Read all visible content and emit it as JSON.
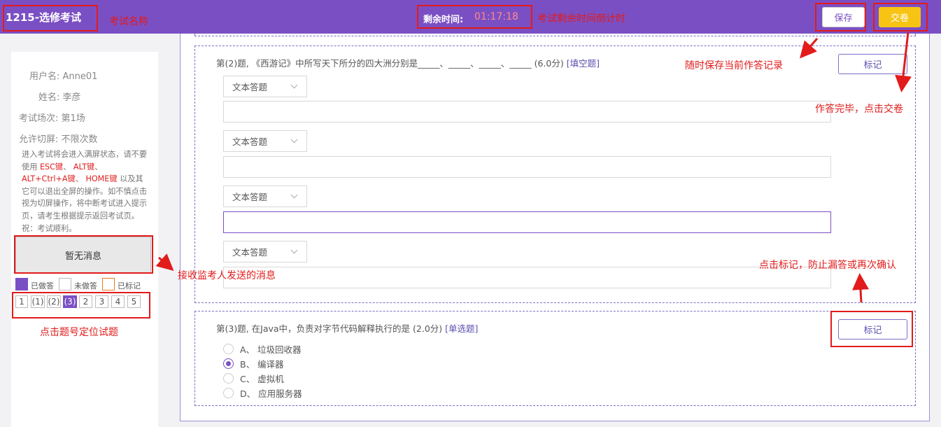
{
  "header": {
    "exam_title": "1215-选修考试",
    "timer_label": "剩余时间:",
    "timer_value": "01:17:18",
    "save_label": "保存",
    "submit_label": "交卷"
  },
  "sidebar": {
    "username": "用户名: Anne01",
    "name": "姓名: 李彦",
    "session": "考试场次: 第1场",
    "switch_allowed": "允许切屏: 不限次数",
    "notice_parts": [
      "进入考试将会进入满屏状态，请不要使用 ",
      "ESC键",
      "、 ",
      "ALT键",
      "、 ",
      "ALT+Ctrl+A键",
      "、 ",
      "HOME键",
      " 以及其它可以退出全屏的操作。如不慎点击视为切屏操作，将中断考试进入提示页，请考生根据提示返回考试页。祝：考试顺利。"
    ],
    "message_box": "暂无消息",
    "legend": {
      "answered": "已做答",
      "unanswered": "未做答",
      "marked": "已标记"
    },
    "question_numbers": [
      "1",
      "(1)",
      "(2)",
      "(3)",
      "2",
      "3",
      "4",
      "5"
    ],
    "active_question": "(3)"
  },
  "questions": [
    {
      "title": "第(2)题, 《西游记》中所写天下所分的四大洲分别是_____、_____、_____、_____ (6.0分)",
      "type": "[填空题]",
      "mark_label": "标记",
      "answer_mode": "文本答题",
      "blanks": [
        "",
        "",
        "",
        ""
      ]
    },
    {
      "title": "第(3)题, 在Java中，负责对字节代码解释执行的是 (2.0分)",
      "type": "[单选题]",
      "mark_label": "标记",
      "options": [
        "A、 垃圾回收器",
        "B、 编译器",
        "C、 虚拟机",
        "D、 应用服务器"
      ],
      "selected": "B"
    }
  ],
  "annotations": {
    "exam_name": "考试名称",
    "countdown": "考试剩余时间倒计时",
    "save_note": "随时保存当前作答记录",
    "submit_note": "作答完毕，点击交卷",
    "message_note": "接收监考人发送的消息",
    "mark_note": "点击标记，防止漏答或再次确认",
    "locate_note": "点击题号定位试题"
  },
  "colors": {
    "brand": "#7b4fc4",
    "submit": "#f7c414",
    "annotation": "#e21b1b"
  }
}
